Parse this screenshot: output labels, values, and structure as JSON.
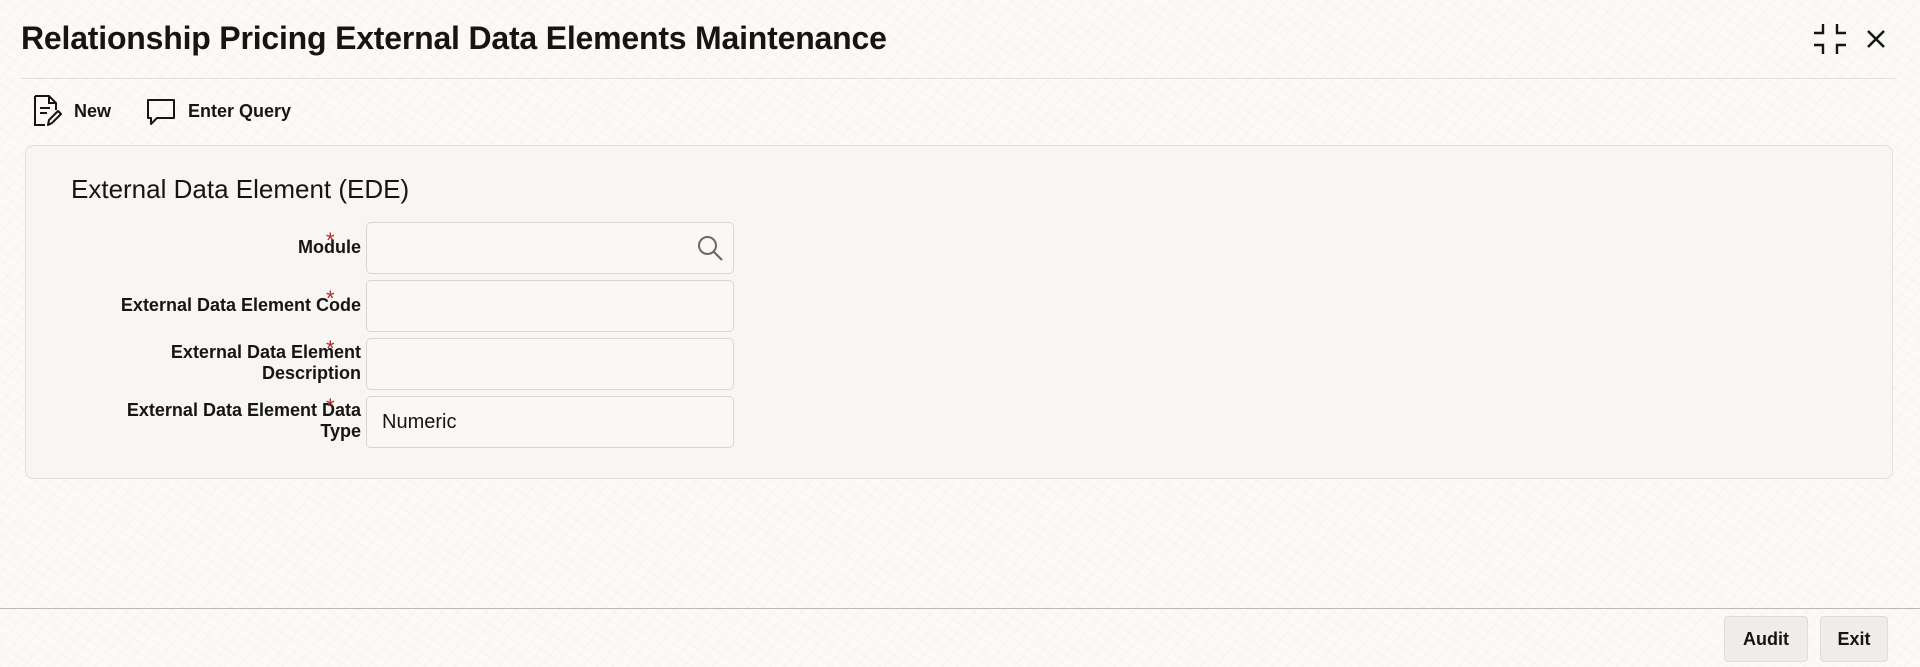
{
  "window": {
    "title": "Relationship Pricing External Data Elements Maintenance",
    "icons": [
      "collapse-icon",
      "close-icon"
    ]
  },
  "toolbar": {
    "new_label": "New",
    "enter_query_label": "Enter Query",
    "icons": [
      "new-document-icon",
      "speech-bubble-icon"
    ]
  },
  "form": {
    "section_title": "External Data Element (EDE)",
    "required_marker": "*",
    "fields": {
      "module": {
        "label": "Module",
        "value": "",
        "icon": "search-icon"
      },
      "code": {
        "label": "External Data Element Code",
        "value": ""
      },
      "description": {
        "label_line1": "External Data Element",
        "label_line2": "Description",
        "value": ""
      },
      "data_type": {
        "label_line1": "External Data Element Data",
        "label_line2": "Type",
        "value": "Numeric"
      }
    }
  },
  "footer": {
    "audit_label": "Audit",
    "exit_label": "Exit"
  },
  "colors": {
    "accent_required": "#b12a2a",
    "text": "#161513",
    "panel_bg": "#f7f6f4"
  }
}
